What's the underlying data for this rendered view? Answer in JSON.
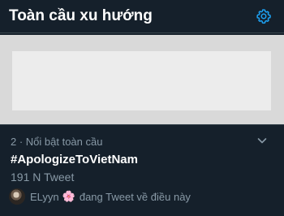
{
  "header": {
    "title": "Toàn cầu xu hướng",
    "settings_icon": "gear-icon",
    "accent_color": "#1da1f2"
  },
  "trend": {
    "meta": "2 · Nổi bật toàn cầu",
    "name": "#ApologizeToVietNam",
    "count": "191 N Tweet",
    "context_user": "ELyyn",
    "context_emoji": "🌸",
    "context_text": "đang Tweet về điều này",
    "menu_icon": "chevron-down-icon"
  },
  "colors": {
    "background": "#15202b",
    "border": "#38444d",
    "secondary_text": "#8899a6",
    "banner_outer": "#d9d9d9",
    "banner_inner": "#ececec"
  }
}
